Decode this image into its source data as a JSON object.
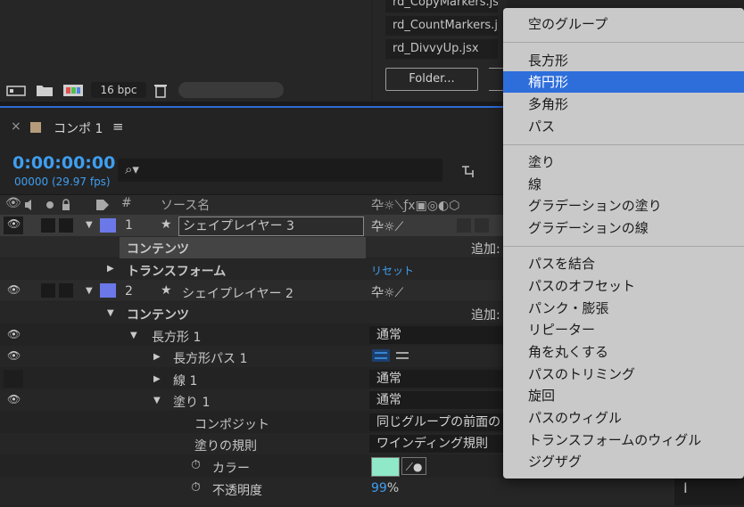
{
  "project_panel": {
    "scripts": [
      "rd_CopyMarkers.jsx",
      "rd_CountMarkers.jsx",
      "rd_DivvyUp.jsx"
    ],
    "folder_button": "Folder...",
    "bpc": "16 bpc"
  },
  "comp": {
    "close": "×",
    "title": "コンポ 1",
    "menu": "≡",
    "timecode": "0:00:00:00",
    "fps": "00000 (29.97 fps)",
    "header": {
      "num": "#",
      "source": "ソース名"
    }
  },
  "layers": [
    {
      "num": "1",
      "name": "シェイプレイヤー 3",
      "contents": "コンテンツ",
      "add": "追加:",
      "transform": "トランスフォーム",
      "reset": "リセット"
    },
    {
      "num": "2",
      "name": "シェイプレイヤー 2",
      "contents": "コンテンツ",
      "add": "追加:"
    }
  ],
  "props": {
    "rect": "長方形 1",
    "rect_mode": "通常",
    "rect_path": "長方形パス 1",
    "stroke": "線 1",
    "stroke_mode": "通常",
    "fill": "塗り 1",
    "fill_mode": "通常",
    "composite": "コンポジット",
    "composite_value": "同じグループの前面の",
    "fill_rule": "塗りの規則",
    "fill_rule_value": "ワインディング規則",
    "color": "カラー",
    "color_value": "#8fe8c8",
    "opacity": "不透明度",
    "opacity_value": "99",
    "opacity_unit": "%"
  },
  "menu": {
    "groups": [
      [
        "空のグループ"
      ],
      [
        "長方形",
        "楕円形",
        "多角形",
        "パス"
      ],
      [
        "塗り",
        "線",
        "グラデーションの塗り",
        "グラデーションの線"
      ],
      [
        "パスを結合",
        "パスのオフセット",
        "パンク・膨張",
        "リピーター",
        "角を丸くする",
        "パスのトリミング",
        "旋回",
        "パスのウィグル",
        "トランスフォームのウィグル",
        "ジグザグ"
      ]
    ],
    "highlighted": "楕円形"
  },
  "colors": {
    "accent": "#2e6edb",
    "timecode": "#3f9ef0",
    "label": "#6b78e8"
  }
}
